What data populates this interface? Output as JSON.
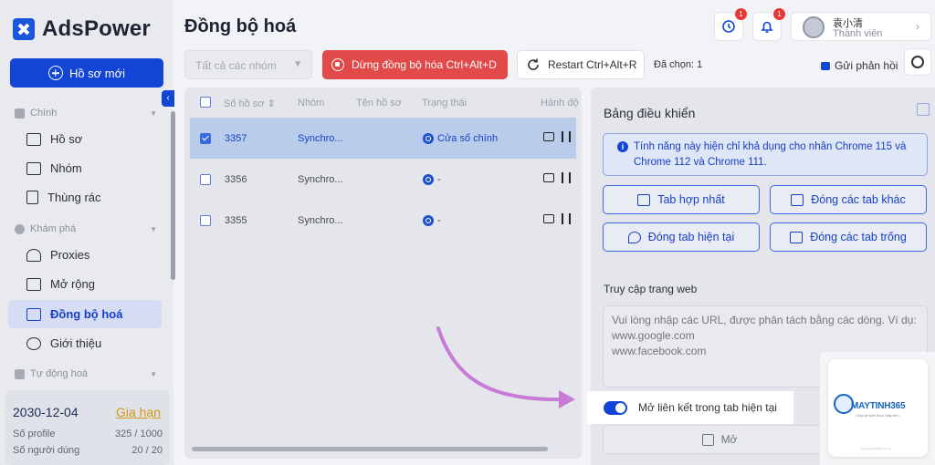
{
  "app": {
    "name": "AdsPower"
  },
  "sidebar": {
    "new_profile_label": "Hồ sơ mới",
    "sections": [
      {
        "title": "Chính",
        "items": [
          "Hồ sơ",
          "Nhóm",
          "Thùng rác"
        ]
      },
      {
        "title": "Khám phá",
        "items": [
          "Proxies",
          "Mở rộng",
          "Đồng bộ hoá",
          "Giới thiệu"
        ]
      },
      {
        "title": "Tự động hoá",
        "items": []
      }
    ],
    "active_item": "Đồng bộ hoá",
    "plan": {
      "expiry": "2030-12-04",
      "renew_label": "Gia hạn",
      "profiles_label": "Số profile",
      "profiles_value": "325 / 1000",
      "users_label": "Số người dùng",
      "users_value": "20 / 20"
    }
  },
  "header": {
    "title": "Đồng bộ hoá",
    "notif_badge_1": "1",
    "notif_badge_2": "1",
    "user_name": "袁小清",
    "user_role": "Thành viên"
  },
  "toolbar": {
    "group_placeholder": "Tất cả các nhóm",
    "stop_sync_label": "Dừng đồng bộ hóa Ctrl+Alt+D",
    "restart_label": "Restart Ctrl+Alt+R",
    "selected_text": "Đã chọn: 1",
    "feedback_label": "Gửi phản hồi"
  },
  "table": {
    "columns": [
      "Số hồ sơ",
      "Nhóm",
      "Tên hồ sơ",
      "Trạng thái",
      "Hành độ"
    ],
    "rows": [
      {
        "id": "3357",
        "group": "Synchro...",
        "name": "",
        "status": "Cửa sổ chính",
        "selected": true
      },
      {
        "id": "3356",
        "group": "Synchro...",
        "name": "",
        "status": "-",
        "selected": false
      },
      {
        "id": "3355",
        "group": "Synchro...",
        "name": "",
        "status": "-",
        "selected": false
      }
    ]
  },
  "control_panel": {
    "title": "Bảng điều khiển",
    "info": "Tính năng này hiện chỉ khả dụng cho nhân Chrome 115 và Chrome 112 và Chrome 111.",
    "buttons": [
      "Tab hợp nhất",
      "Đóng các tab khác",
      "Đóng tab hiện tại",
      "Đóng các tab trống"
    ],
    "web_access_label": "Truy cập trang web",
    "url_placeholder": "Vui lòng nhập các URL, được phân tách bằng các dòng. Ví dụ:\nwww.google.com\nwww.facebook.com",
    "toggle_label": "Mở liên kết trong tab hiện tại",
    "toggle_on": true,
    "open_label": "Mở"
  },
  "watermark": {
    "brand": "MAYTINH365",
    "tagline": "Chia sẻ kiến thức Máy tính",
    "url": "www.maytinh365.com.vn"
  },
  "colors": {
    "primary": "#1245d6",
    "danger": "#e24a4a",
    "renew": "#d39a10",
    "annotation_arrow": "#c97ad6"
  }
}
